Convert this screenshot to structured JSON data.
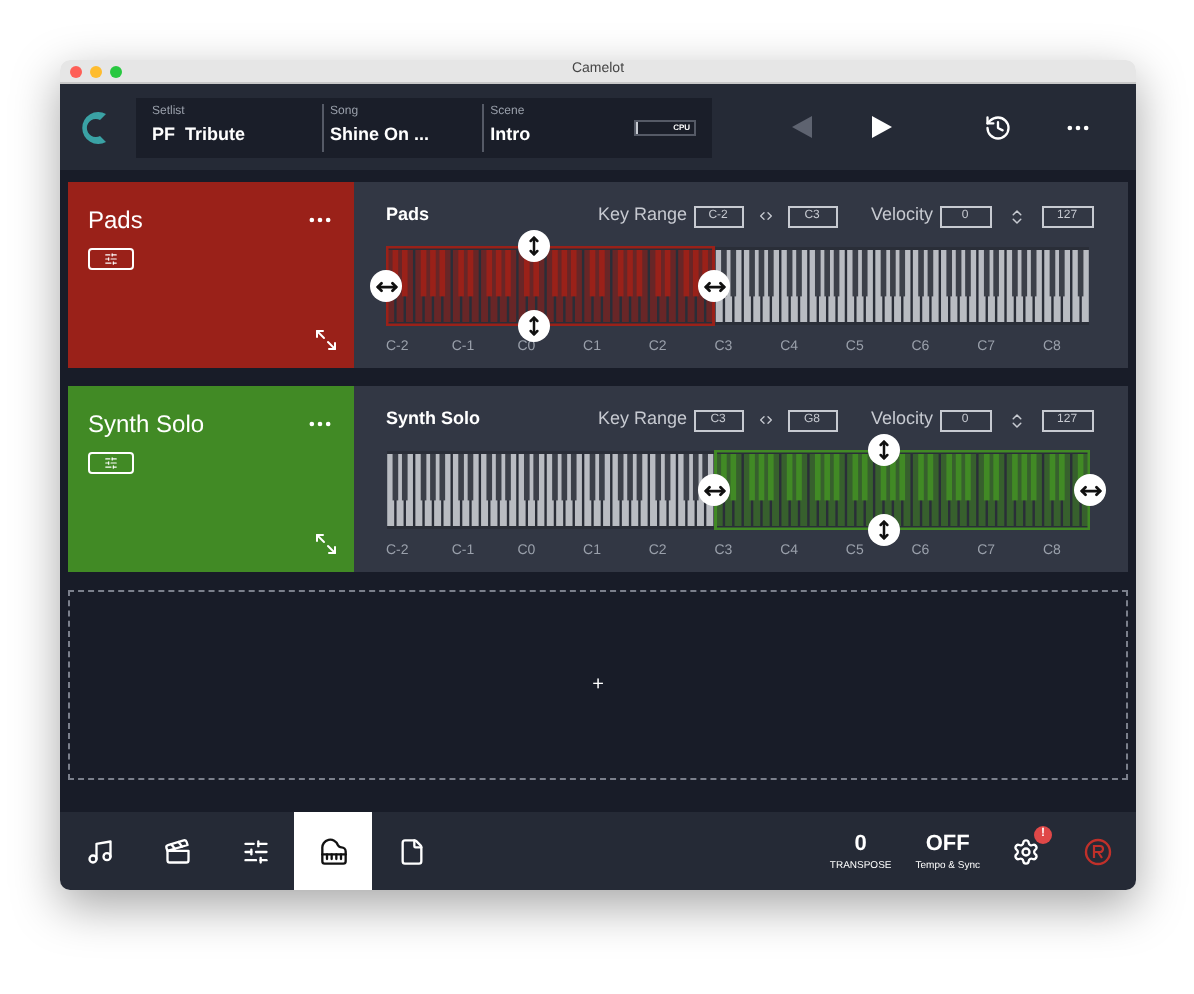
{
  "window": {
    "title": "Camelot"
  },
  "header": {
    "fields": [
      {
        "label": "Setlist",
        "value": "PF  Tribute"
      },
      {
        "label": "Song",
        "value": "Shine On ..."
      },
      {
        "label": "Scene",
        "value": "Intro"
      }
    ],
    "cpu": {
      "label": "CPU",
      "level": 0.04
    },
    "prev": {
      "disabled": true
    },
    "play": {
      "disabled": false
    }
  },
  "layers": [
    {
      "name": "Pads",
      "color": "#9a2119",
      "title": "Pads",
      "key_range_label": "Key Range",
      "low": "C-2",
      "high": "C3",
      "velocity_label": "Velocity",
      "vel_low": "0",
      "vel_high": "127",
      "octaves": [
        {
          "label": "C-2",
          "in_range": true
        },
        {
          "label": "C-1",
          "in_range": true
        },
        {
          "label": "C0",
          "in_range": true
        },
        {
          "label": "C1",
          "in_range": true
        },
        {
          "label": "C2",
          "in_range": true
        },
        {
          "label": "C3",
          "in_range": false
        },
        {
          "label": "C4",
          "in_range": false
        },
        {
          "label": "C5",
          "in_range": false
        },
        {
          "label": "C6",
          "in_range": false
        },
        {
          "label": "C7",
          "in_range": false
        },
        {
          "label": "C8",
          "in_range": false
        }
      ]
    },
    {
      "name": "Synth Solo",
      "color": "#418a25",
      "title": "Synth Solo",
      "key_range_label": "Key Range",
      "low": "C3",
      "high": "G8",
      "velocity_label": "Velocity",
      "vel_low": "0",
      "vel_high": "127",
      "octaves": [
        {
          "label": "C-2",
          "in_range": false
        },
        {
          "label": "C-1",
          "in_range": false
        },
        {
          "label": "C0",
          "in_range": false
        },
        {
          "label": "C1",
          "in_range": false
        },
        {
          "label": "C2",
          "in_range": false
        },
        {
          "label": "C3",
          "in_range": true
        },
        {
          "label": "C4",
          "in_range": true
        },
        {
          "label": "C5",
          "in_range": true
        },
        {
          "label": "C6",
          "in_range": true
        },
        {
          "label": "C7",
          "in_range": true
        },
        {
          "label": "C8",
          "in_range": true
        }
      ]
    }
  ],
  "add_zone": {
    "symbol": "+"
  },
  "toolbar": {
    "tabs": [
      {
        "kind": "music",
        "selected": false
      },
      {
        "kind": "scenes",
        "selected": false
      },
      {
        "kind": "mixer",
        "selected": false
      },
      {
        "kind": "keyboard",
        "selected": true
      },
      {
        "kind": "document",
        "selected": false
      }
    ],
    "transpose": {
      "value": "0",
      "label": "TRANSPOSE"
    },
    "tempo": {
      "value": "OFF",
      "label": "Tempo & Sync"
    },
    "settings_badge": "!"
  }
}
